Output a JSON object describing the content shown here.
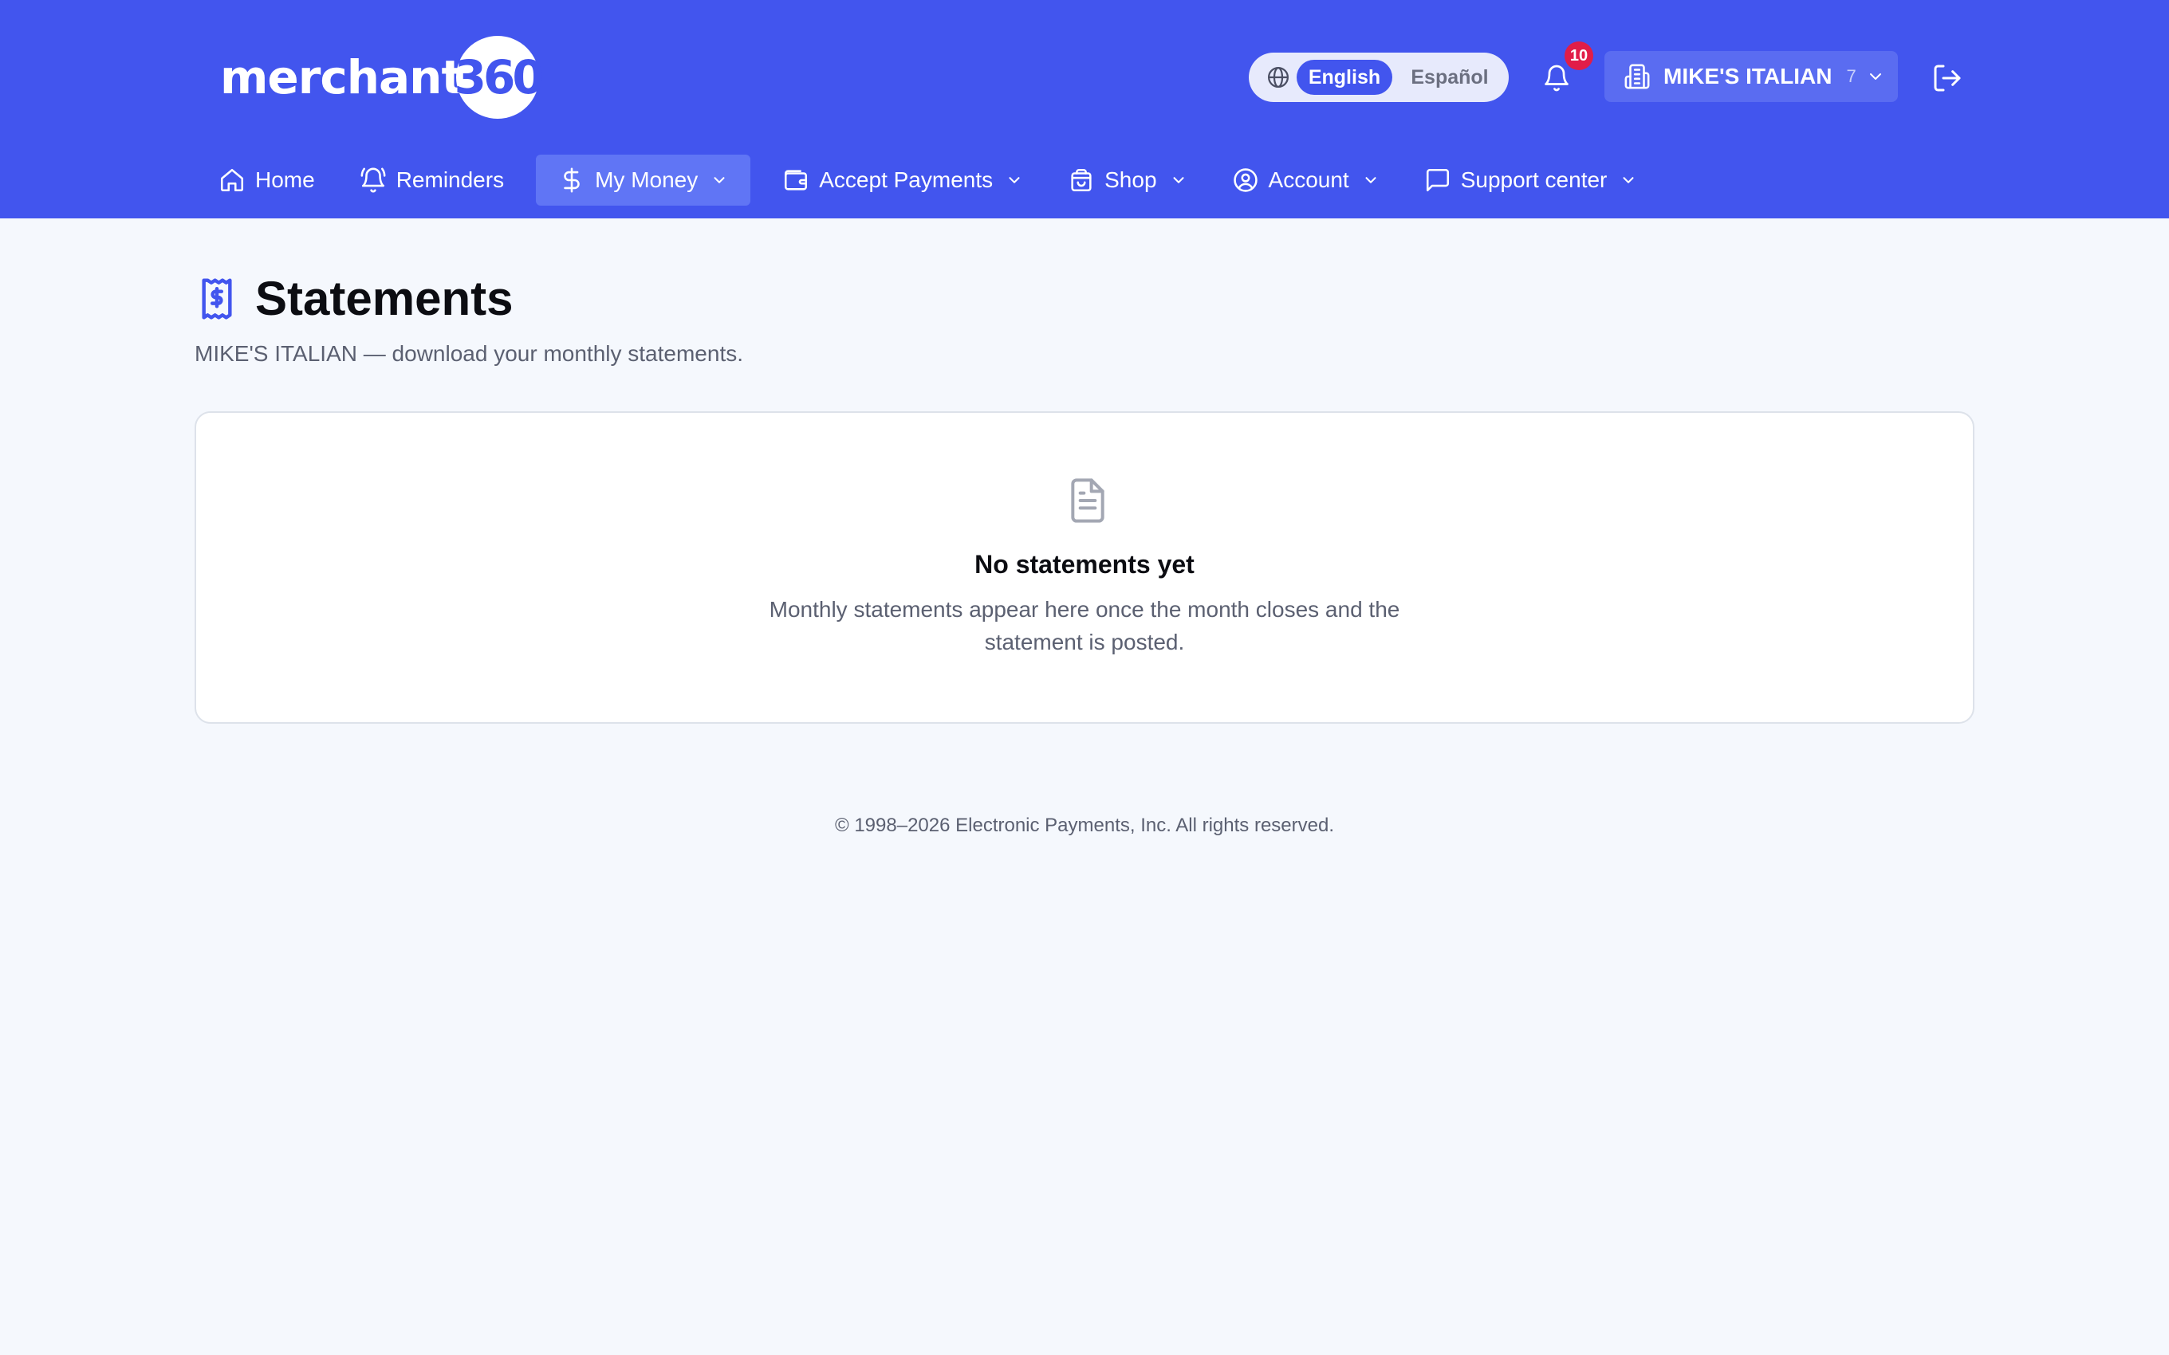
{
  "brand": {
    "logo_text": "merchant",
    "logo_number": "360",
    "header_color": "#4255ee"
  },
  "language": {
    "icon": "globe-icon",
    "options": [
      "English",
      "Español"
    ],
    "selected": "English"
  },
  "notifications": {
    "icon": "bell-icon",
    "count": "10"
  },
  "merchant": {
    "icon": "building-icon",
    "name": "MIKE'S ITALIAN",
    "count": "7"
  },
  "logout": {
    "icon": "logout-icon"
  },
  "nav": {
    "items": [
      {
        "label": "Home",
        "icon": "home-icon",
        "dropdown": false
      },
      {
        "label": "Reminders",
        "icon": "bell-ring-icon",
        "dropdown": false
      },
      {
        "label": "My Money",
        "icon": "dollar-icon",
        "dropdown": true,
        "active": true
      },
      {
        "label": "Accept Payments",
        "icon": "wallet-icon",
        "dropdown": true
      },
      {
        "label": "Shop",
        "icon": "shopping-bag-icon",
        "dropdown": true
      },
      {
        "label": "Account",
        "icon": "user-circle-icon",
        "dropdown": true
      },
      {
        "label": "Support center",
        "icon": "message-square-icon",
        "dropdown": true
      }
    ]
  },
  "page": {
    "icon": "receipt-dollar-icon",
    "title": "Statements",
    "subtitle": "MIKE'S ITALIAN — download your monthly statements."
  },
  "empty_state": {
    "icon": "document-icon",
    "title": "No statements yet",
    "description": "Monthly statements appear here once the month closes and the statement is posted."
  },
  "footer": {
    "text": "© 1998–2026 Electronic Payments, Inc. All rights reserved."
  }
}
